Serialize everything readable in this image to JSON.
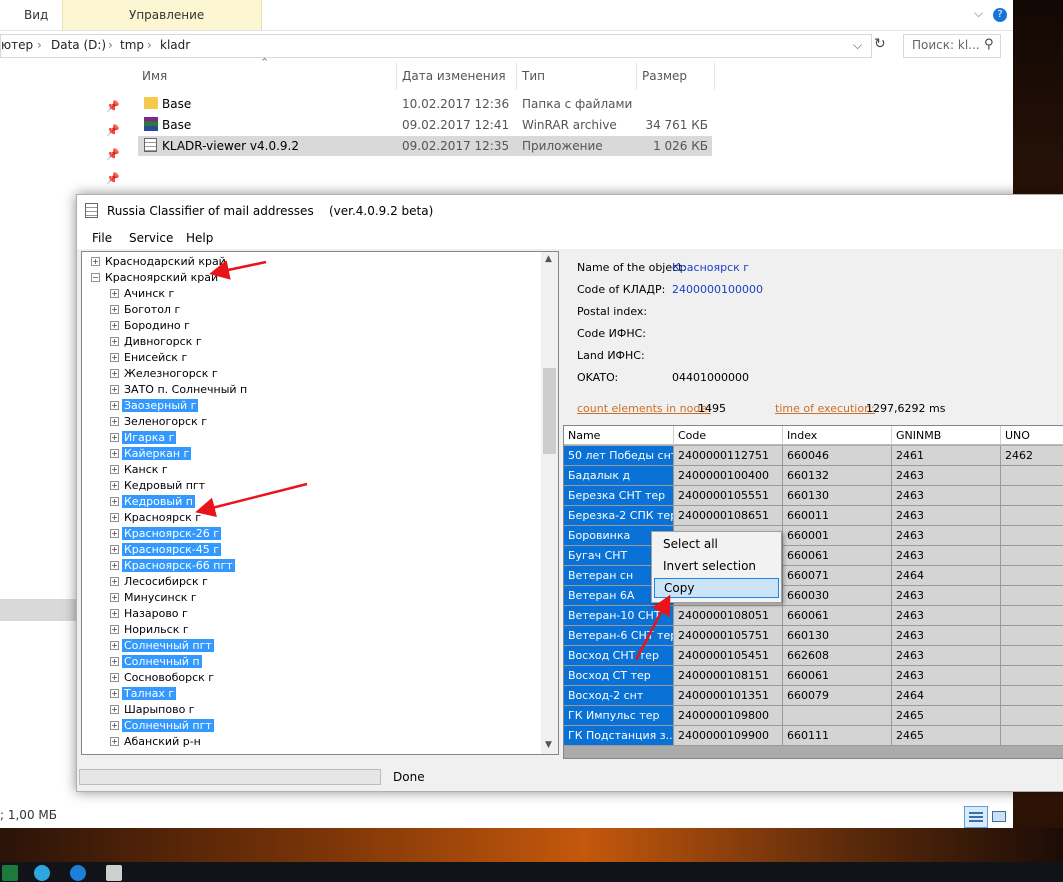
{
  "explorer": {
    "ribbon_tabs": [
      "Вид",
      "Управление"
    ],
    "address_parts": [
      "ютер",
      "Data (D:)",
      "tmp",
      "kladr"
    ],
    "search_placeholder": "Поиск: kl...",
    "columns": [
      "Имя",
      "Дата изменения",
      "Тип",
      "Размер"
    ],
    "files": [
      {
        "name": "Base",
        "date": "10.02.2017 12:36",
        "type": "Папка с файлами",
        "size": "",
        "icon": "folder-icon"
      },
      {
        "name": "Base",
        "date": "09.02.2017 12:41",
        "type": "WinRAR archive",
        "size": "34 761 КБ",
        "icon": "winrar-icon"
      },
      {
        "name": "KLADR-viewer v4.0.9.2",
        "date": "09.02.2017 12:35",
        "type": "Приложение",
        "size": "1 026 КБ",
        "icon": "app-icon"
      }
    ],
    "status_text": "; 1,00 МБ"
  },
  "kladr": {
    "title": "Russia Classifier of mail addresses    (ver.4.0.9.2 beta)",
    "menu": [
      "File",
      "Service",
      "Help"
    ],
    "tree": [
      {
        "label": "Краснодарский край",
        "level": 0,
        "selected": false,
        "expanded": false
      },
      {
        "label": "Красноярский край",
        "level": 0,
        "selected": false,
        "expanded": true
      },
      {
        "label": "Ачинск г",
        "level": 1,
        "selected": false
      },
      {
        "label": "Боготол г",
        "level": 1,
        "selected": false
      },
      {
        "label": "Бородино г",
        "level": 1,
        "selected": false
      },
      {
        "label": "Дивногорск г",
        "level": 1,
        "selected": false
      },
      {
        "label": "Енисейск г",
        "level": 1,
        "selected": false
      },
      {
        "label": "Железногорск г",
        "level": 1,
        "selected": false
      },
      {
        "label": "ЗАТО п. Солнечный п",
        "level": 1,
        "selected": false
      },
      {
        "label": "Заозерный г",
        "level": 1,
        "selected": true
      },
      {
        "label": "Зеленогорск г",
        "level": 1,
        "selected": false
      },
      {
        "label": "Игарка г",
        "level": 1,
        "selected": true
      },
      {
        "label": "Кайеркан г",
        "level": 1,
        "selected": true
      },
      {
        "label": "Канск г",
        "level": 1,
        "selected": false
      },
      {
        "label": "Кедровый пгт",
        "level": 1,
        "selected": false
      },
      {
        "label": "Кедровый п",
        "level": 1,
        "selected": true
      },
      {
        "label": "Красноярск г",
        "level": 1,
        "selected": false
      },
      {
        "label": "Красноярск-26 г",
        "level": 1,
        "selected": true
      },
      {
        "label": "Красноярск-45 г",
        "level": 1,
        "selected": true
      },
      {
        "label": "Красноярск-66 пгт",
        "level": 1,
        "selected": true
      },
      {
        "label": "Лесосибирск г",
        "level": 1,
        "selected": false
      },
      {
        "label": "Минусинск г",
        "level": 1,
        "selected": false
      },
      {
        "label": "Назарово г",
        "level": 1,
        "selected": false
      },
      {
        "label": "Норильск г",
        "level": 1,
        "selected": false
      },
      {
        "label": "Солнечный пгт",
        "level": 1,
        "selected": true
      },
      {
        "label": "Солнечный п",
        "level": 1,
        "selected": true
      },
      {
        "label": "Сосновоборск г",
        "level": 1,
        "selected": false
      },
      {
        "label": "Талнах г",
        "level": 1,
        "selected": true
      },
      {
        "label": "Шарыпово г",
        "level": 1,
        "selected": false
      },
      {
        "label": "Солнечный пгт",
        "level": 1,
        "selected": true
      },
      {
        "label": "Абанский р-н",
        "level": 1,
        "selected": false
      }
    ],
    "info": {
      "name_label": "Name of the object:",
      "name_value": "Красноярск г",
      "code_label": "Code of КЛАДР:",
      "code_value": "2400000100000",
      "postal_label": "Postal index:",
      "ifns_label": "Code ИФНС:",
      "land_label": "Land ИФНС:",
      "okato_label": "OKATO:",
      "okato_value": "04401000000",
      "count_label": "count elements in node:",
      "count_value": "1495",
      "time_label": "time of execution:",
      "time_value": "1297,6292 ms"
    },
    "grid": {
      "headers": [
        "Name",
        "Code",
        "Index",
        "GNINMB",
        "UNO"
      ],
      "rows": [
        [
          "50 лет Победы снт",
          "2400000112751",
          "660046",
          "2461",
          "2462"
        ],
        [
          "Бадалык д",
          "2400000100400",
          "660132",
          "2463",
          ""
        ],
        [
          "Березка СНТ тер",
          "2400000105551",
          "660130",
          "2463",
          ""
        ],
        [
          "Березка-2 СПК тер",
          "2400000108651",
          "660011",
          "2463",
          ""
        ],
        [
          "Боровинка",
          "",
          "660001",
          "2463",
          ""
        ],
        [
          "Бугач СНТ",
          "",
          "660061",
          "2463",
          ""
        ],
        [
          "Ветеран сн",
          "",
          "660071",
          "2464",
          ""
        ],
        [
          "Ветеран 6А",
          "",
          "660030",
          "2463",
          ""
        ],
        [
          "Ветеран-10 СНТ",
          "2400000108051",
          "660061",
          "2463",
          ""
        ],
        [
          "Ветеран-6 СНТ тер",
          "2400000105751",
          "660130",
          "2463",
          ""
        ],
        [
          "Восход СНТ тер",
          "2400000105451",
          "662608",
          "2463",
          ""
        ],
        [
          "Восход СТ тер",
          "2400000108151",
          "660061",
          "2463",
          ""
        ],
        [
          "Восход-2 снт",
          "2400000101351",
          "660079",
          "2464",
          ""
        ],
        [
          "ГК Импульс тер",
          "2400000109800",
          "",
          "2465",
          ""
        ],
        [
          "ГК Подстанция з...",
          "2400000109900",
          "660111",
          "2465",
          ""
        ]
      ]
    },
    "status": "Done",
    "context_menu": [
      "Select all",
      "Invert selection",
      "Copy"
    ]
  }
}
